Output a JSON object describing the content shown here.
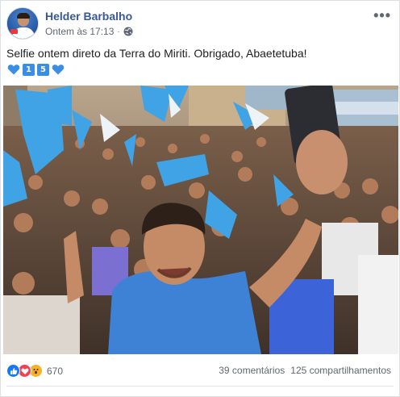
{
  "post": {
    "author": "Helder Barbalho",
    "timestamp": "Ontem às 17:13",
    "separator": "·",
    "privacy_icon": "globe-icon",
    "more_icon": "more-options-icon",
    "text": "Selfie ontem direto da Terra do Miriti. Obrigado, Abaetetuba!",
    "emoji_numbers": [
      "1",
      "5"
    ],
    "photo_description_icon": "crowd-selfie-photo"
  },
  "footer": {
    "reaction_count": "670",
    "reaction_types": [
      "like",
      "love",
      "wow"
    ],
    "comments": "39 comentários",
    "shares": "125 compartilhamentos"
  },
  "colors": {
    "author_link": "#385898",
    "meta_text": "#606770",
    "emoji_blue": "#3a8ee6",
    "flag_blue": "#3fa3e6"
  }
}
